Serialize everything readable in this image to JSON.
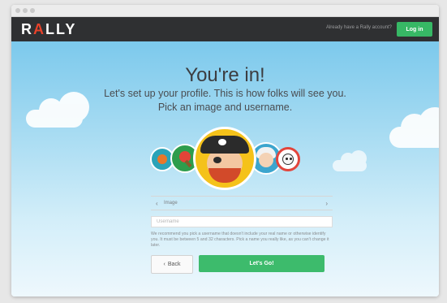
{
  "header": {
    "logo": "RALLY",
    "account_question": "Already have a Rally account?",
    "login_label": "Log in"
  },
  "main": {
    "title": "You're in!",
    "subtitle": "Let's set up your profile. This is how folks will see you. Pick an image and username."
  },
  "avatars": [
    {
      "name": "basketball-avatar"
    },
    {
      "name": "ping-pong-avatar"
    },
    {
      "name": "pirate-avatar",
      "selected": true
    },
    {
      "name": "granny-avatar"
    },
    {
      "name": "panda-avatar"
    }
  ],
  "form": {
    "image_select_value": "Image",
    "username_placeholder": "Username",
    "help_text": "We recommend you pick a username that doesn't include your real name or otherwise identify you. It must be between 5 and 32 characters. Pick a name you really like, as you can't change it later.",
    "back_label": "Back",
    "submit_label": "Let's Go!"
  },
  "colors": {
    "topbar": "#2f3032",
    "accent": "#37b865",
    "logo_accent": "#e8422a"
  }
}
